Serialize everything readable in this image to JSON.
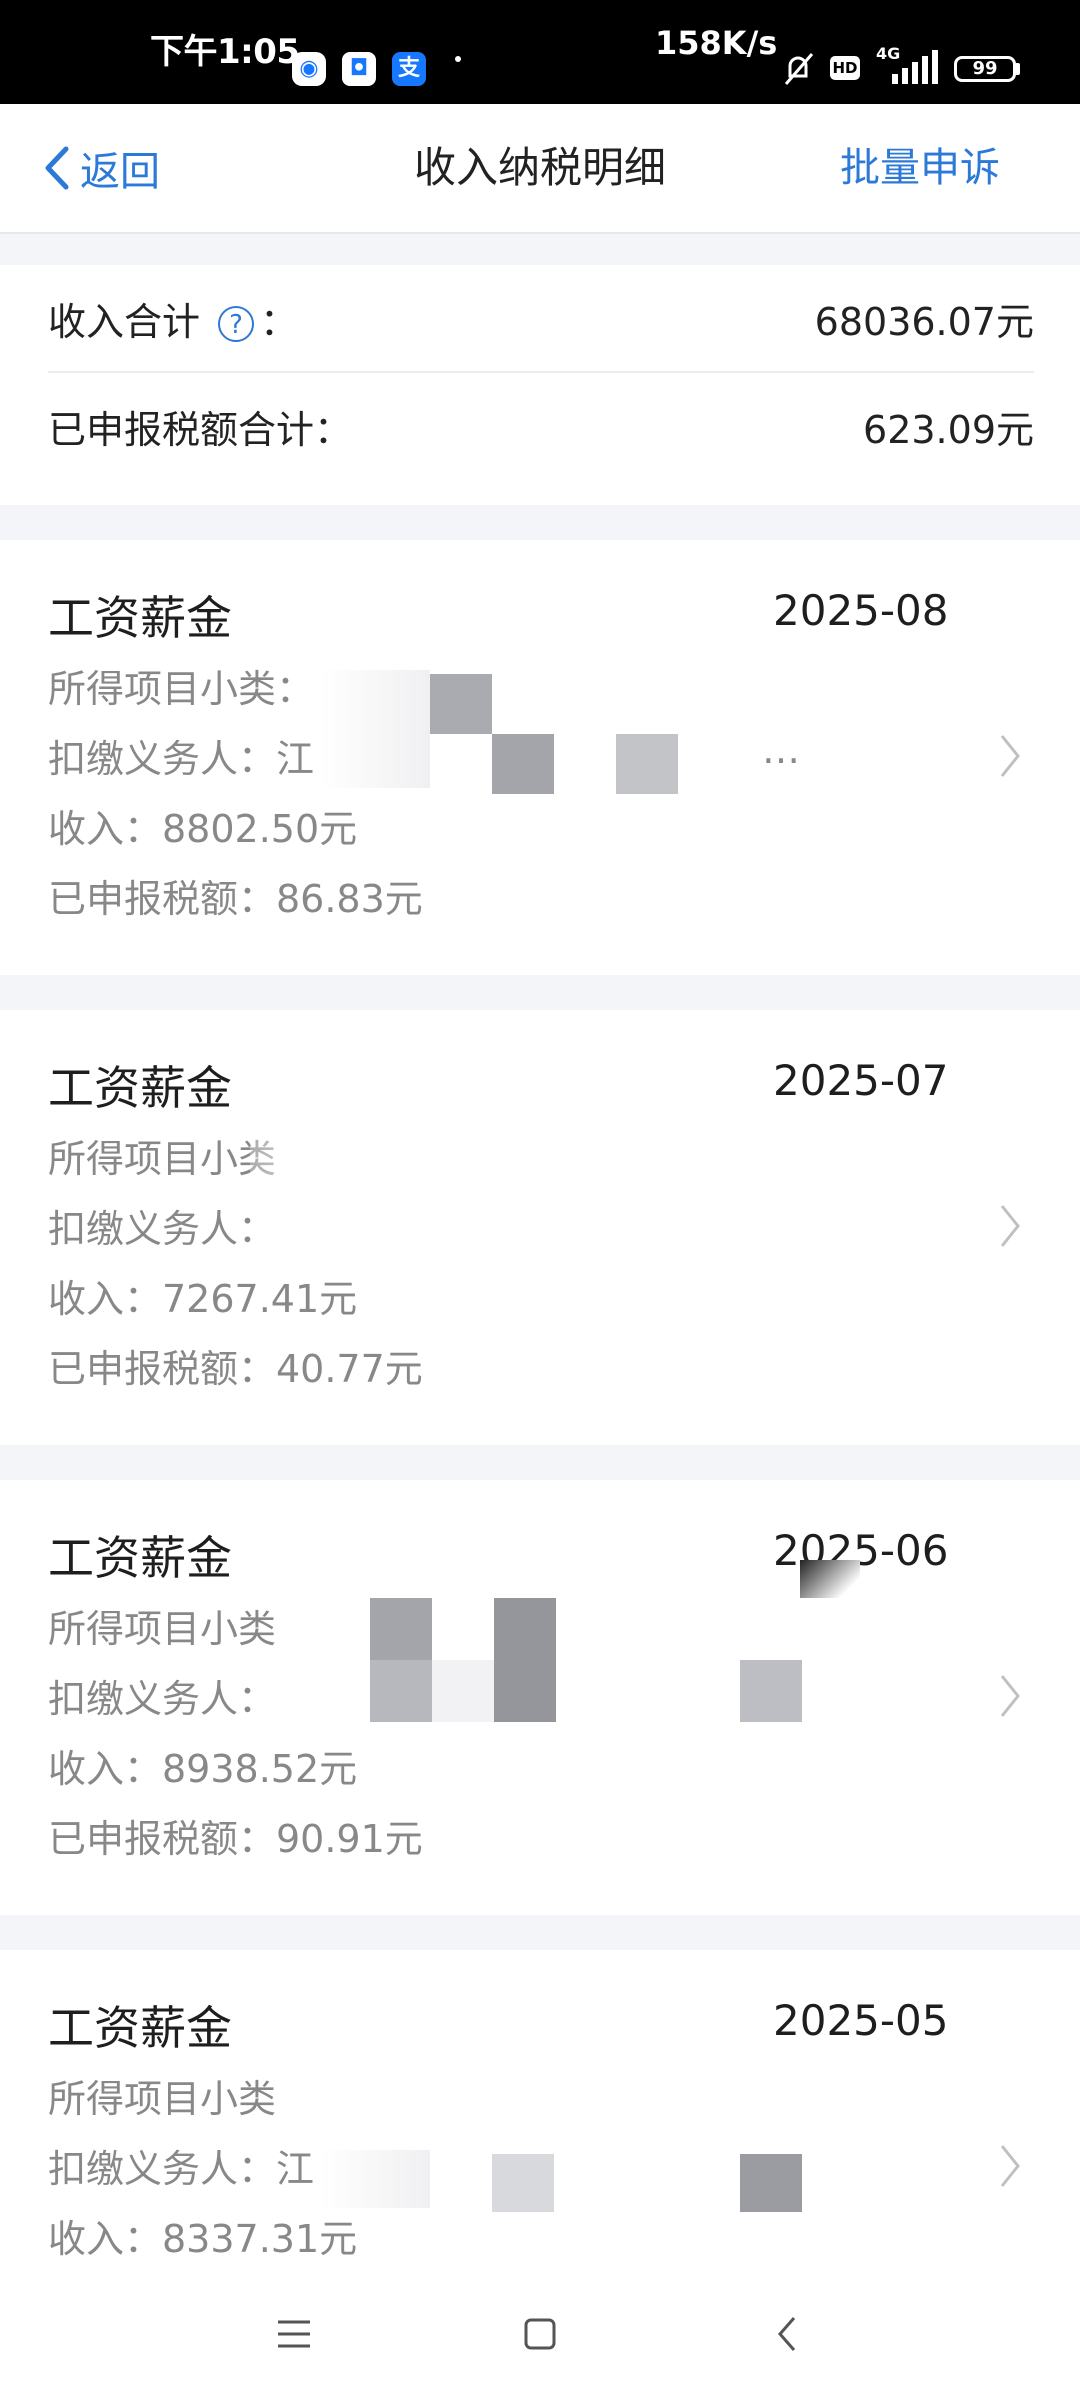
{
  "status_bar": {
    "time": "下午1:05",
    "net_speed": "158K/s",
    "hd": "HD",
    "network": "4G",
    "battery": "99",
    "app_icons": [
      "qq-browser-icon",
      "app-icon",
      "alipay-icon"
    ],
    "alipay_char": "支"
  },
  "nav": {
    "back_label": "返回",
    "title": "收入纳税明细",
    "action_label": "批量申诉"
  },
  "summary": {
    "income_label": "收入合计",
    "income_colon": "：",
    "income_value": "68036.07元",
    "tax_label": "已申报税额合计：",
    "tax_value": "623.09元"
  },
  "records": [
    {
      "category": "工资薪金",
      "date": "2025-08",
      "subcategory": "所得项目小类：",
      "withholder": "扣缴义务人：江",
      "withholder_tail": "…",
      "income": "收入：8802.50元",
      "tax": "已申报税额：86.83元"
    },
    {
      "category": "工资薪金",
      "date": "2025-07",
      "subcategory": "所得项目小类",
      "withholder": "扣缴义务人：",
      "withholder_tail": "",
      "income": "收入：7267.41元",
      "tax": "已申报税额：40.77元"
    },
    {
      "category": "工资薪金",
      "date": "2025-06",
      "subcategory": "所得项目小类",
      "withholder": "扣缴义务人：",
      "withholder_tail": "",
      "income": "收入：8938.52元",
      "tax": "已申报税额：90.91元"
    },
    {
      "category": "工资薪金",
      "date": "2025-05",
      "subcategory": "所得项目小类",
      "withholder": "扣缴义务人：江",
      "withholder_tail": "",
      "income": "收入：8337.31元",
      "tax": ""
    }
  ],
  "colors": {
    "accent": "#2c79d8",
    "muted_text": "#888888",
    "background": "#f4f5f9"
  }
}
